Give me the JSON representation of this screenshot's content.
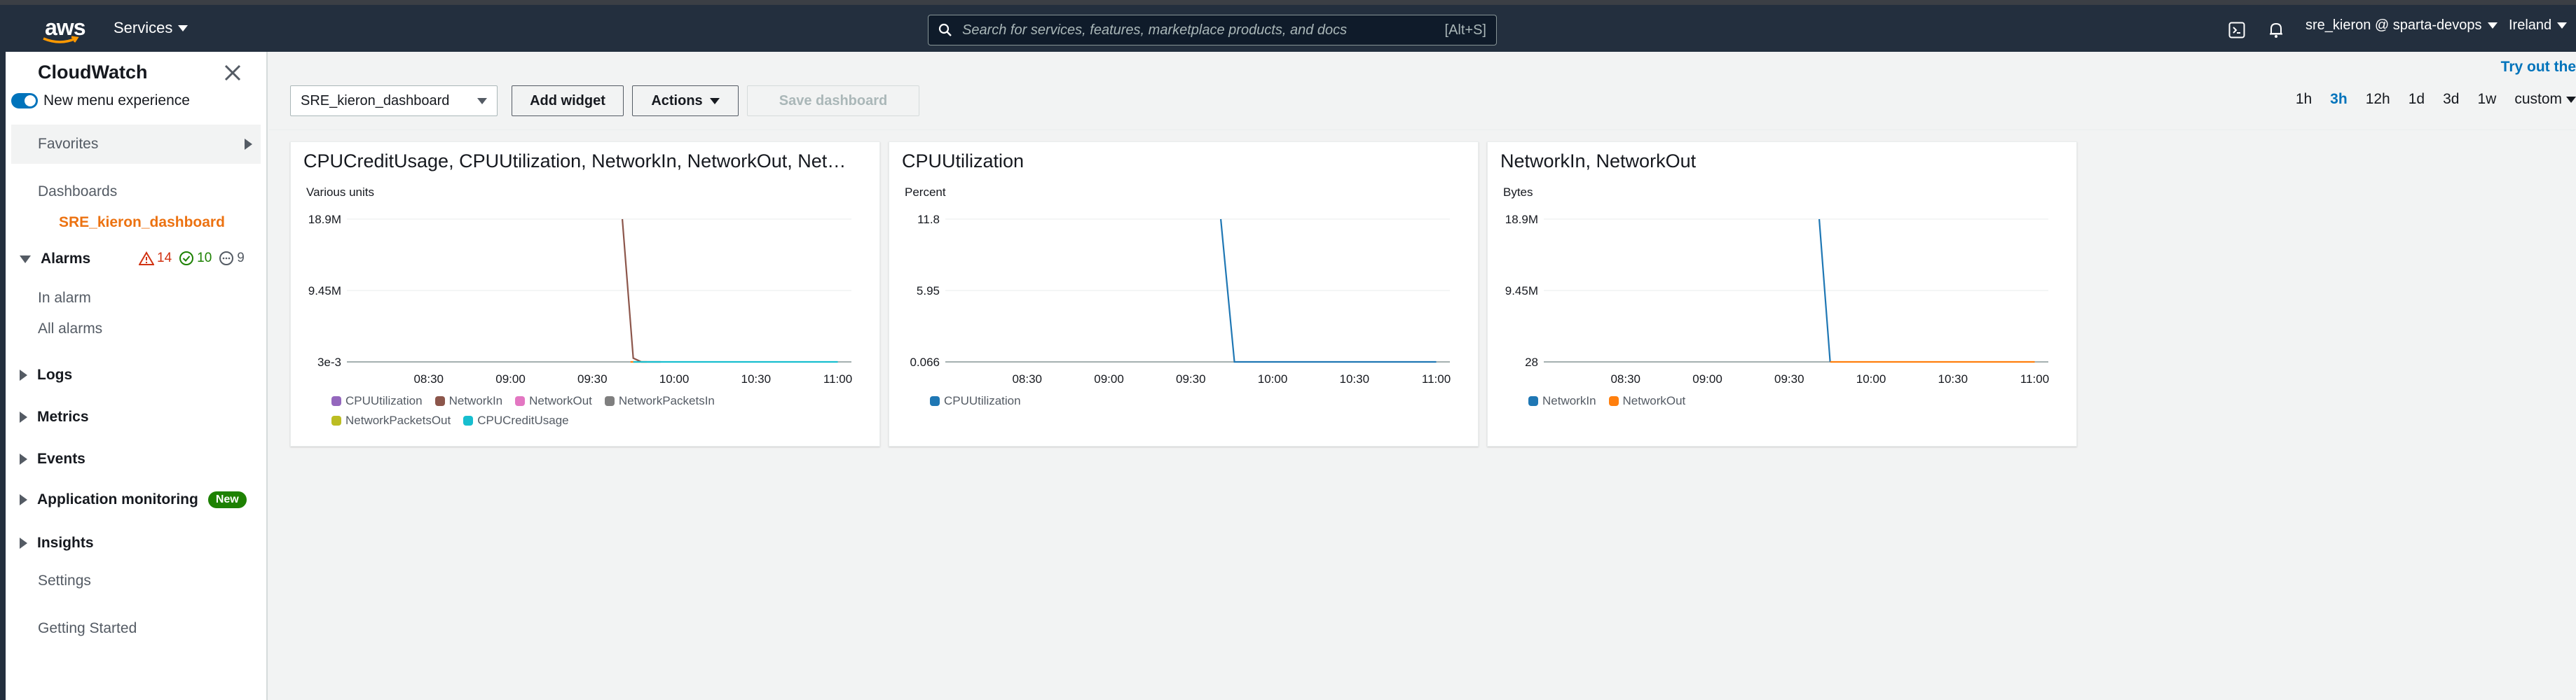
{
  "topnav": {
    "logo_text": "aws",
    "services_label": "Services",
    "search_placeholder": "Search for services, features, marketplace products, and docs",
    "search_shortcut": "[Alt+S]",
    "account_label": "sre_kieron @ sparta-devops",
    "region_label": "Ireland"
  },
  "sidebar": {
    "title": "CloudWatch",
    "new_menu_label": "New menu experience",
    "favorites_label": "Favorites",
    "dashboards_label": "Dashboards",
    "active_dashboard": "SRE_kieron_dashboard",
    "alarms_label": "Alarms",
    "alarm_counts": {
      "in_alarm": "14",
      "ok": "10",
      "insufficient": "9"
    },
    "in_alarm_label": "In alarm",
    "all_alarms_label": "All alarms",
    "logs_label": "Logs",
    "metrics_label": "Metrics",
    "events_label": "Events",
    "app_monitoring_label": "Application monitoring",
    "new_badge": "New",
    "insights_label": "Insights",
    "settings_label": "Settings",
    "getting_started_label": "Getting Started"
  },
  "toolbar": {
    "dashboard_select": "SRE_kieron_dashboard",
    "add_widget": "Add widget",
    "actions": "Actions",
    "save_dashboard": "Save dashboard",
    "tryout": "Try out the",
    "time_ranges": [
      "1h",
      "3h",
      "12h",
      "1d",
      "3d",
      "1w"
    ],
    "selected_range": "3h",
    "custom": "custom"
  },
  "colors": {
    "CPUUtilization_all": "#9467bd",
    "NetworkIn_all": "#8c564b",
    "NetworkOut_all": "#e377c2",
    "NetworkPacketsIn": "#7f7f7f",
    "NetworkPacketsOut": "#bcbd22",
    "CPUCreditUsage": "#17becf",
    "blue": "#1f77b4",
    "orange": "#ff7f0e"
  },
  "chart_data": [
    {
      "type": "line",
      "title": "CPUCreditUsage, CPUUtilization, NetworkIn, NetworkOut, Net…",
      "ylabel": "Various units",
      "y_ticks": [
        "18.9M",
        "9.45M",
        "3e-3"
      ],
      "ylim": [
        0.003,
        18900000
      ],
      "x_ticks": [
        "08:30",
        "09:00",
        "09:30",
        "10:00",
        "10:30",
        "11:00"
      ],
      "x_ticks_minutes": [
        510,
        540,
        570,
        600,
        630,
        660
      ],
      "x_range_minutes": [
        480,
        665
      ],
      "legend_rows": [
        [
          "CPUUtilization",
          "NetworkIn",
          "NetworkOut",
          "NetworkPacketsIn"
        ],
        [
          "NetworkPacketsOut",
          "CPUCreditUsage"
        ]
      ],
      "series": [
        {
          "name": "NetworkIn",
          "color_key": "NetworkIn_all",
          "x": [
            581,
            585,
            588,
            595
          ],
          "y": [
            18900000,
            500000,
            0.003,
            0.003
          ]
        },
        {
          "name": "NetworkOut",
          "color_key": "orange",
          "x": [
            584,
            590
          ],
          "y": [
            0.003,
            0.003
          ]
        },
        {
          "name": "CPUCreditUsage",
          "color_key": "CPUCreditUsage",
          "x": [
            585,
            600,
            630,
            660
          ],
          "y": [
            0.003,
            0.003,
            0.003,
            0.003
          ]
        }
      ]
    },
    {
      "type": "line",
      "title": "CPUUtilization",
      "ylabel": "Percent",
      "y_ticks": [
        "11.8",
        "5.95",
        "0.066"
      ],
      "ylim": [
        0.066,
        11.8
      ],
      "x_ticks": [
        "08:30",
        "09:00",
        "09:30",
        "10:00",
        "10:30",
        "11:00"
      ],
      "x_ticks_minutes": [
        510,
        540,
        570,
        600,
        630,
        660
      ],
      "x_range_minutes": [
        480,
        665
      ],
      "legend_rows": [
        [
          "CPUUtilization"
        ]
      ],
      "series": [
        {
          "name": "CPUUtilization",
          "color_key": "blue",
          "x": [
            581,
            586,
            600,
            630,
            660
          ],
          "y": [
            11.8,
            0.066,
            0.066,
            0.066,
            0.066
          ]
        }
      ]
    },
    {
      "type": "line",
      "title": "NetworkIn, NetworkOut",
      "ylabel": "Bytes",
      "y_ticks": [
        "18.9M",
        "9.45M",
        "28"
      ],
      "ylim": [
        28,
        18900000
      ],
      "x_ticks": [
        "08:30",
        "09:00",
        "09:30",
        "10:00",
        "10:30",
        "11:00"
      ],
      "x_ticks_minutes": [
        510,
        540,
        570,
        600,
        630,
        660
      ],
      "x_range_minutes": [
        480,
        665
      ],
      "legend_rows": [
        [
          "NetworkIn",
          "NetworkOut"
        ]
      ],
      "series": [
        {
          "name": "NetworkIn",
          "color_key": "blue",
          "x": [
            581,
            585
          ],
          "y": [
            18900000,
            28
          ]
        },
        {
          "name": "NetworkOut",
          "color_key": "orange",
          "x": [
            585,
            600,
            630,
            660
          ],
          "y": [
            28,
            28,
            28,
            28
          ]
        }
      ]
    }
  ]
}
